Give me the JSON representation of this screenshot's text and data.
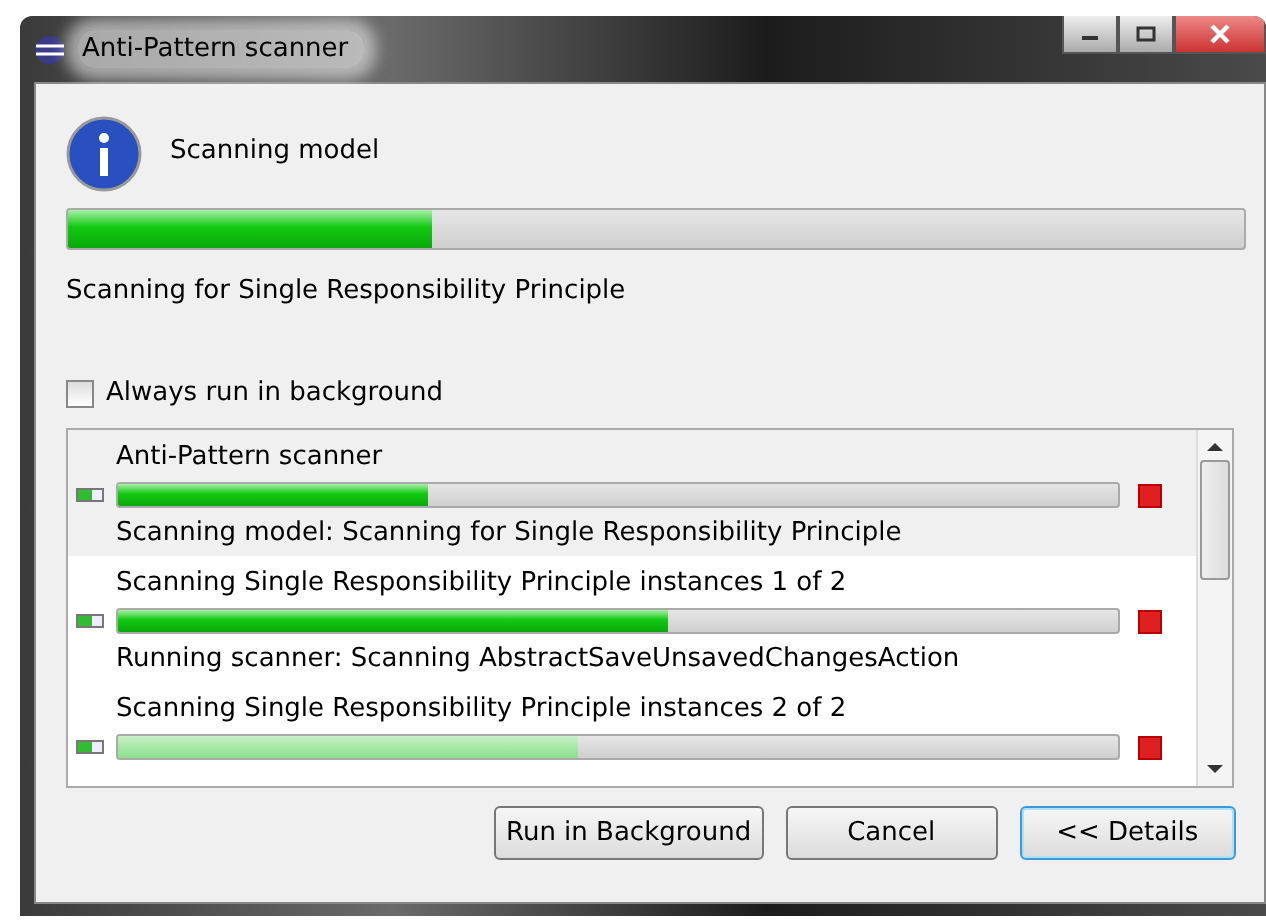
{
  "window": {
    "title": "Anti-Pattern scanner"
  },
  "header": {
    "title": "Scanning model"
  },
  "progress": {
    "level": 0.31
  },
  "status": "Scanning for Single Responsibility Principle",
  "always_run_in_background": {
    "label": "Always run in background",
    "checked": false
  },
  "jobs": [
    {
      "name": "Anti-Pattern scanner",
      "level": 0.31,
      "detail": "Scanning model: Scanning for Single Responsibility Principle",
      "selected": true
    },
    {
      "name": "Scanning Single Responsibility Principle instances 1 of 2",
      "level": 0.55,
      "detail": "Running scanner: Scanning AbstractSaveUnsavedChangesAction",
      "selected": false
    },
    {
      "name": "Scanning Single Responsibility Principle instances 2 of 2",
      "level": 0.46,
      "selected": false
    }
  ],
  "buttons": [
    {
      "label": "Run in Background",
      "default": false
    },
    {
      "label": "Cancel",
      "default": false
    },
    {
      "label": "<< Details",
      "default": true
    }
  ]
}
